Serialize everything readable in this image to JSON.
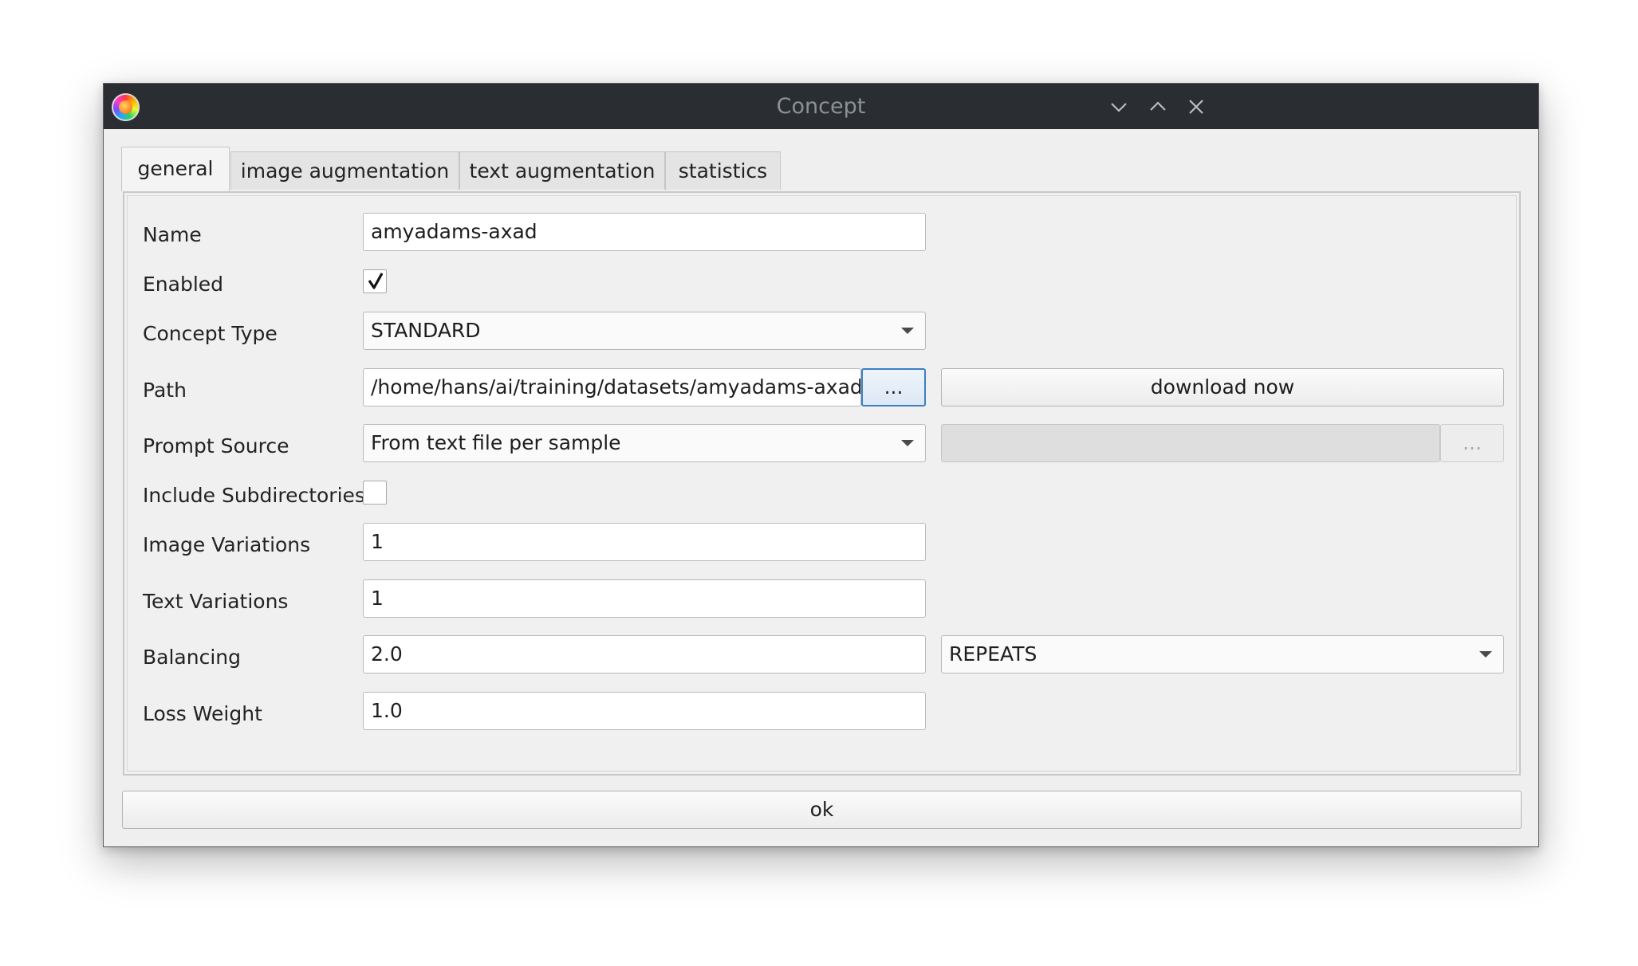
{
  "window": {
    "title": "Concept",
    "app_icon": "app-logo-icon",
    "controls": [
      "minimize-icon",
      "maximize-icon",
      "close-icon"
    ]
  },
  "tabs": [
    {
      "label": "general",
      "active": true
    },
    {
      "label": "image augmentation",
      "active": false
    },
    {
      "label": "text augmentation",
      "active": false
    },
    {
      "label": "statistics",
      "active": false
    }
  ],
  "form": {
    "name": {
      "label": "Name",
      "value": "amyadams-axad"
    },
    "enabled": {
      "label": "Enabled",
      "checked": true
    },
    "concept_type": {
      "label": "Concept Type",
      "value": "STANDARD"
    },
    "path": {
      "label": "Path",
      "value": "/home/hans/ai/training/datasets/amyadams-axad",
      "browse_label": "...",
      "download_label": "download now"
    },
    "prompt_source": {
      "label": "Prompt Source",
      "value": "From text file per sample",
      "extra_value": "",
      "browse_label": "..."
    },
    "include_subdirectories": {
      "label": "Include Subdirectories",
      "checked": false
    },
    "image_variations": {
      "label": "Image Variations",
      "value": "1"
    },
    "text_variations": {
      "label": "Text Variations",
      "value": "1"
    },
    "balancing": {
      "label": "Balancing",
      "value": "2.0",
      "strategy": "REPEATS"
    },
    "loss_weight": {
      "label": "Loss Weight",
      "value": "1.0"
    }
  },
  "footer": {
    "ok_label": "ok"
  },
  "colors": {
    "titlebar": "#2a2e32",
    "window_bg": "#efefef",
    "focus_border": "#3d7fc4"
  }
}
